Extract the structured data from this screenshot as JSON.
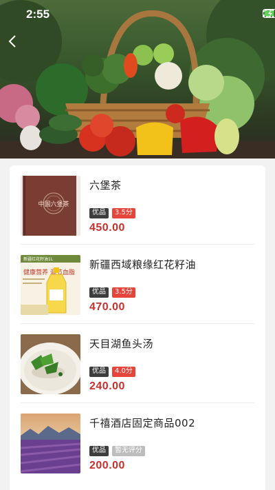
{
  "status_bar": {
    "time": "2:55"
  },
  "products": [
    {
      "name": "六堡茶",
      "tag_quality": "优品",
      "rating": "3.5分",
      "rating_style": "red",
      "price": "450.00",
      "thumb": "tea-book-cover",
      "cover_text": "中国六堡茶"
    },
    {
      "name": "新疆西域粮缘红花籽油",
      "tag_quality": "优品",
      "rating": "3.5分",
      "rating_style": "red",
      "price": "470.00",
      "thumb": "oil-bottle",
      "banner_text": "新疆红花籽油1L",
      "slogan": "健康营养 调节血脂"
    },
    {
      "name": "天目湖鱼头汤",
      "tag_quality": "优品",
      "rating": "4.0分",
      "rating_style": "red",
      "price": "240.00",
      "thumb": "fish-soup"
    },
    {
      "name": "千禧酒店固定商品002",
      "tag_quality": "优品",
      "rating": "暂无评分",
      "rating_style": "gray",
      "price": "200.00",
      "thumb": "lavender-field"
    }
  ]
}
